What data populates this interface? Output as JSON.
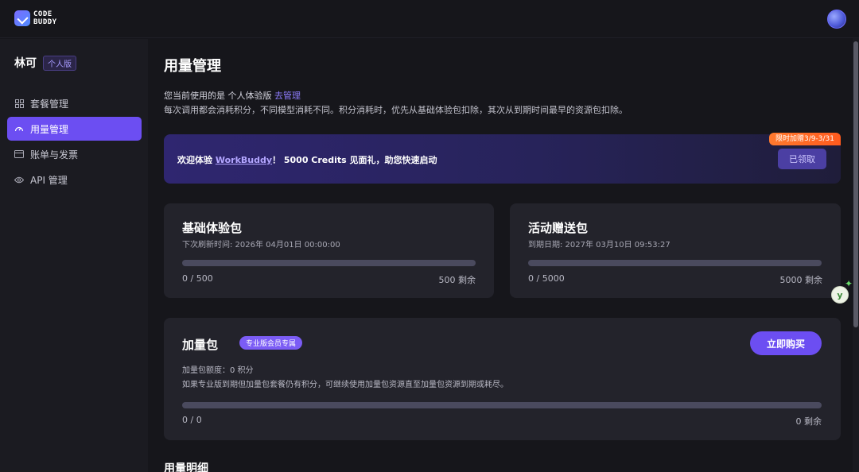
{
  "brand": {
    "logo_line1": "CODE",
    "logo_line2": "BUDDY"
  },
  "sidebar": {
    "user_name": "林可",
    "plan_tag": "个人版",
    "items": [
      {
        "label": "套餐管理",
        "icon": "grid-icon",
        "active": false
      },
      {
        "label": "用量管理",
        "icon": "gauge-icon",
        "active": true
      },
      {
        "label": "账单与发票",
        "icon": "card-icon",
        "active": false
      },
      {
        "label": "API 管理",
        "icon": "eye-icon",
        "active": false
      }
    ]
  },
  "main": {
    "title": "用量管理",
    "plan_prefix": "您当前使用的是 个人体验版 ",
    "plan_link": "去管理",
    "description": "每次调用都会消耗积分，不同模型消耗不同。积分消耗时，优先从基础体验包扣除，其次从到期时间最早的资源包扣除。",
    "banner": {
      "text_prefix": "欢迎体验 ",
      "text_link": "WorkBuddy",
      "text_suffix": "！ 5000 Credits 见面礼，助您快速启动",
      "badge": "限时加赠3/9-3/31",
      "button": "已领取"
    },
    "basic_pack": {
      "title": "基础体验包",
      "subtitle": "下次刷新时间: 2026年 04月01日 00:00:00",
      "used": "0 / 500",
      "remaining": "500 剩余",
      "progress": 0
    },
    "gift_pack": {
      "title": "活动赠送包",
      "subtitle": "到期日期:   2027年 03月10日 09:53:27",
      "used": "0 / 5000",
      "remaining": "5000 剩余",
      "progress": 0
    },
    "addon_pack": {
      "title": "加量包",
      "tag": "专业版会员专属",
      "buy_button": "立即购买",
      "quota": "加量包额度：0 积分",
      "description": "如果专业版到期但加量包套餐仍有积分，可继续使用加量包资源直至加量包资源到期或耗尽。",
      "used": "0 / 0",
      "remaining": "0 剩余",
      "progress": 0
    },
    "section_title": "用量明细"
  },
  "colors": {
    "accent": "#6c4ef2",
    "badge": "#ff6a24",
    "track": "#4a4a5e"
  }
}
